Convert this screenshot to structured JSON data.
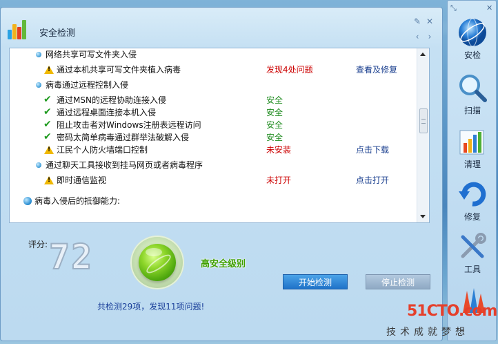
{
  "window": {
    "title": "安全检测"
  },
  "checks": [
    {
      "type": "category",
      "label": "网络共享可写文件夹入侵"
    },
    {
      "type": "warn",
      "label": "通过本机共享可写文件夹植入病毒",
      "status": "发现4处问题",
      "status_color": "red",
      "action": "查看及修复"
    },
    {
      "type": "category",
      "label": "病毒通过远程控制入侵"
    },
    {
      "type": "ok",
      "label": "通过MSN的远程协助连接入侵",
      "status": "安全",
      "status_color": "green"
    },
    {
      "type": "ok",
      "label": "通过远程桌面连接本机入侵",
      "status": "安全",
      "status_color": "green"
    },
    {
      "type": "ok",
      "label": "阻止攻击者对Windows注册表远程访问",
      "status": "安全",
      "status_color": "green"
    },
    {
      "type": "ok",
      "label": "密码太简单病毒通过群举法破解入侵",
      "status": "安全",
      "status_color": "green"
    },
    {
      "type": "warn",
      "label": "江民个人防火墙端口控制",
      "status": "未安装",
      "status_color": "red",
      "action": "点击下载"
    },
    {
      "type": "category",
      "label": "通过聊天工具接收到挂马网页或者病毒程序"
    },
    {
      "type": "warn",
      "label": "即时通信监视",
      "status": "未打开",
      "status_color": "red",
      "action": "点击打开"
    },
    {
      "type": "section",
      "label": "病毒入侵后的抵御能力:"
    }
  ],
  "score": {
    "label": "评分:",
    "value": "72",
    "level": "高安全级别"
  },
  "summary": "共检测29项，发现11项问题!",
  "buttons": {
    "start": "开始检测",
    "stop": "停止检测"
  },
  "sidebar": [
    {
      "label": "安检",
      "icon": "globe-icon"
    },
    {
      "label": "扫描",
      "icon": "magnifier-icon"
    },
    {
      "label": "清理",
      "icon": "chart-icon"
    },
    {
      "label": "修复",
      "icon": "repair-arrow-icon"
    },
    {
      "label": "工具",
      "icon": "tools-icon"
    },
    {
      "label": "",
      "icon": "firewall-icon"
    }
  ],
  "watermark": {
    "logo": "51CTO.com",
    "tagline": "技术成就梦想"
  },
  "colors": {
    "red": "#cc0000",
    "green": "#1c8a1c",
    "link": "#1a3f8f",
    "accent": "#1f72c8"
  }
}
